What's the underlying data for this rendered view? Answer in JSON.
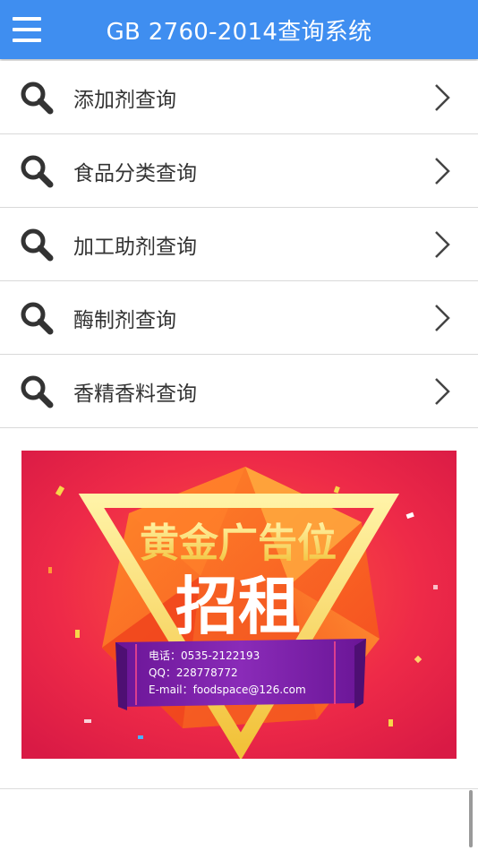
{
  "header": {
    "title": "GB 2760-2014查询系统",
    "menu_icon": "hamburger-menu-icon",
    "bg_color": "#3f8ef0"
  },
  "menu": {
    "items": [
      {
        "label": "添加剂查询",
        "icon": "search-icon"
      },
      {
        "label": "食品分类查询",
        "icon": "search-icon"
      },
      {
        "label": "加工助剂查询",
        "icon": "search-icon"
      },
      {
        "label": "酶制剂查询",
        "icon": "search-icon"
      },
      {
        "label": "香精香料查询",
        "icon": "search-icon"
      }
    ]
  },
  "banner": {
    "headline": "黄金广告位",
    "subline": "招租",
    "phone": "电话：0535-2122193",
    "qq": "QQ：228778772",
    "email": "E-mail：foodspace@126.com",
    "colors": {
      "background": "#e8234a",
      "accent": "#f7d64a",
      "ribbon": "#7a1fa0"
    }
  }
}
